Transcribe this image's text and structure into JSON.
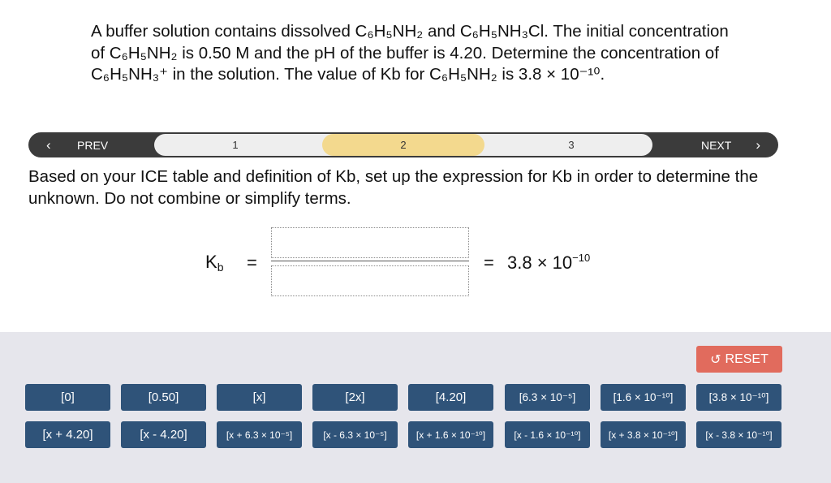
{
  "question": "A buffer solution contains dissolved C₆H₅NH₂ and C₆H₅NH₃Cl. The initial concentration of C₆H₅NH₂ is 0.50 M and the pH of the buffer is 4.20. Determine the concentration of C₆H₅NH₃⁺ in the solution. The value of Kb for C₆H₅NH₂ is 3.8 × 10⁻¹⁰.",
  "nav": {
    "prev_label": "PREV",
    "next_label": "NEXT",
    "steps": [
      "1",
      "2",
      "3"
    ],
    "active_step": "2"
  },
  "instruction": "Based on your ICE table and definition of Kb, set up the expression for Kb in order to determine the unknown. Do not combine or simplify terms.",
  "equation": {
    "lhs_main": "K",
    "lhs_sub": "b",
    "equals": "=",
    "rhs_mantissa": "3.8 × 10",
    "rhs_exponent": "−10",
    "numerator_value": "",
    "denominator_value": ""
  },
  "reset_label": "RESET",
  "tiles_row1": [
    "[0]",
    "[0.50]",
    "[x]",
    "[2x]",
    "[4.20]",
    "[6.3 × 10⁻⁵]",
    "[1.6 × 10⁻¹⁰]",
    "[3.8 × 10⁻¹⁰]"
  ],
  "tiles_row2": [
    "[x + 4.20]",
    "[x - 4.20]",
    "[x + 6.3 × 10⁻⁵]",
    "[x - 6.3 × 10⁻⁵]",
    "[x + 1.6 × 10⁻¹⁰]",
    "[x - 1.6 × 10⁻¹⁰]",
    "[x + 3.8 × 10⁻¹⁰]",
    "[x - 3.8 × 10⁻¹⁰]"
  ],
  "colors": {
    "tile_bg": "#2f5379",
    "reset_bg": "#e16b5d",
    "active_step_bg": "#f3d98e",
    "nav_bg": "#3b3b3b",
    "tray_bg": "#e6e6ec"
  }
}
